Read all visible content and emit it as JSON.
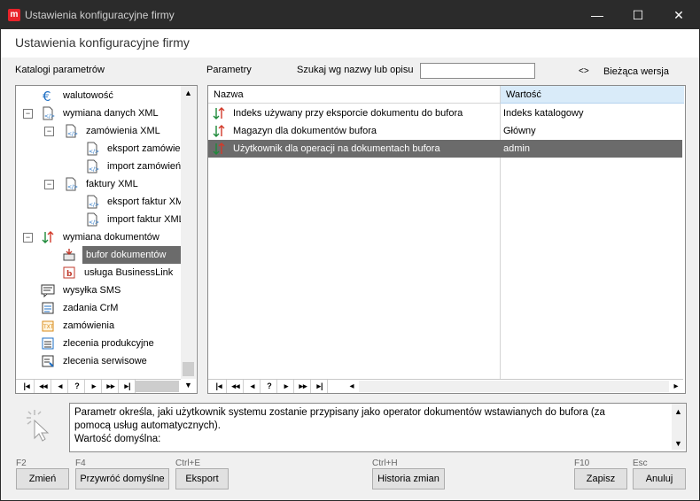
{
  "window": {
    "app_icon": "m",
    "title": "Ustawienia konfiguracyjne firmy",
    "minimize": "—",
    "maximize": "☐",
    "close": "✕"
  },
  "page_title": "Ustawienia konfiguracyjne firmy",
  "left_panel_label": "Katalogi parametrów",
  "right_panel_label": "Parametry",
  "search": {
    "label": "Szukaj wg nazwy lub opisu",
    "value": ""
  },
  "version": {
    "toggle": "<>",
    "label": "Bieżąca wersja"
  },
  "tree": {
    "items": [
      {
        "label": "walutowość",
        "icon": "euro-icon"
      },
      {
        "label": "wymiana danych XML",
        "icon": "xml-file-icon",
        "expander": "−"
      },
      {
        "label": "zamówienia XML",
        "icon": "xml-file-icon",
        "expander": "−"
      },
      {
        "label": "eksport zamówie",
        "icon": "xml-file-icon"
      },
      {
        "label": "import zamówień",
        "icon": "xml-file-icon"
      },
      {
        "label": "faktury XML",
        "icon": "xml-file-icon",
        "expander": "−"
      },
      {
        "label": "eksport faktur XM",
        "icon": "xml-file-icon"
      },
      {
        "label": "import faktur XML",
        "icon": "xml-file-icon"
      },
      {
        "label": "wymiana dokumentów",
        "icon": "exchange-arrows-icon",
        "expander": "−"
      },
      {
        "label": "bufor dokumentów",
        "icon": "buffer-icon"
      },
      {
        "label": "usługa BusinessLink",
        "icon": "businesslink-icon"
      },
      {
        "label": "wysyłka SMS",
        "icon": "sms-icon"
      },
      {
        "label": "zadania CrM",
        "icon": "crm-tasks-icon"
      },
      {
        "label": "zamówienia",
        "icon": "orders-icon"
      },
      {
        "label": "zlecenia produkcyjne",
        "icon": "production-orders-icon"
      },
      {
        "label": "zlecenia serwisowe",
        "icon": "service-orders-icon"
      }
    ],
    "selected_index": 9
  },
  "nav_buttons": [
    "|◂",
    "◂◂",
    "◂",
    "?",
    "▸",
    "▸▸",
    "▸|"
  ],
  "grid": {
    "columns": [
      "Nazwa",
      "Wartość"
    ],
    "rows": [
      {
        "name": "Indeks używany przy eksporcie dokumentu do bufora",
        "value": "Indeks katalogowy"
      },
      {
        "name": "Magazyn dla dokumentów bufora",
        "value": "Główny"
      },
      {
        "name": "Użytkownik dla operacji na dokumentach bufora",
        "value": "admin"
      }
    ],
    "selected_index": 2
  },
  "description": {
    "line1": "Parametr określa, jaki użytkownik systemu zostanie przypisany jako operator dokumentów wstawianych do bufora (za",
    "line2": "pomocą usług automatycznych).",
    "line3": "Wartość domyślna:"
  },
  "buttons": {
    "change": {
      "label": "Zmień",
      "key": "F2"
    },
    "restore": {
      "label": "Przywróć domyślne",
      "key": "F4"
    },
    "export": {
      "label": "Eksport",
      "key": "Ctrl+E"
    },
    "history": {
      "label": "Historia zmian",
      "key": "Ctrl+H"
    },
    "save": {
      "label": "Zapisz",
      "key": "F10"
    },
    "cancel": {
      "label": "Anuluj",
      "key": "Esc"
    }
  },
  "colors": {
    "selection": "#6b6b6b",
    "header_highlight": "#d9ebf9",
    "titlebar": "#2b2b2b",
    "app_icon": "#e8232a"
  }
}
